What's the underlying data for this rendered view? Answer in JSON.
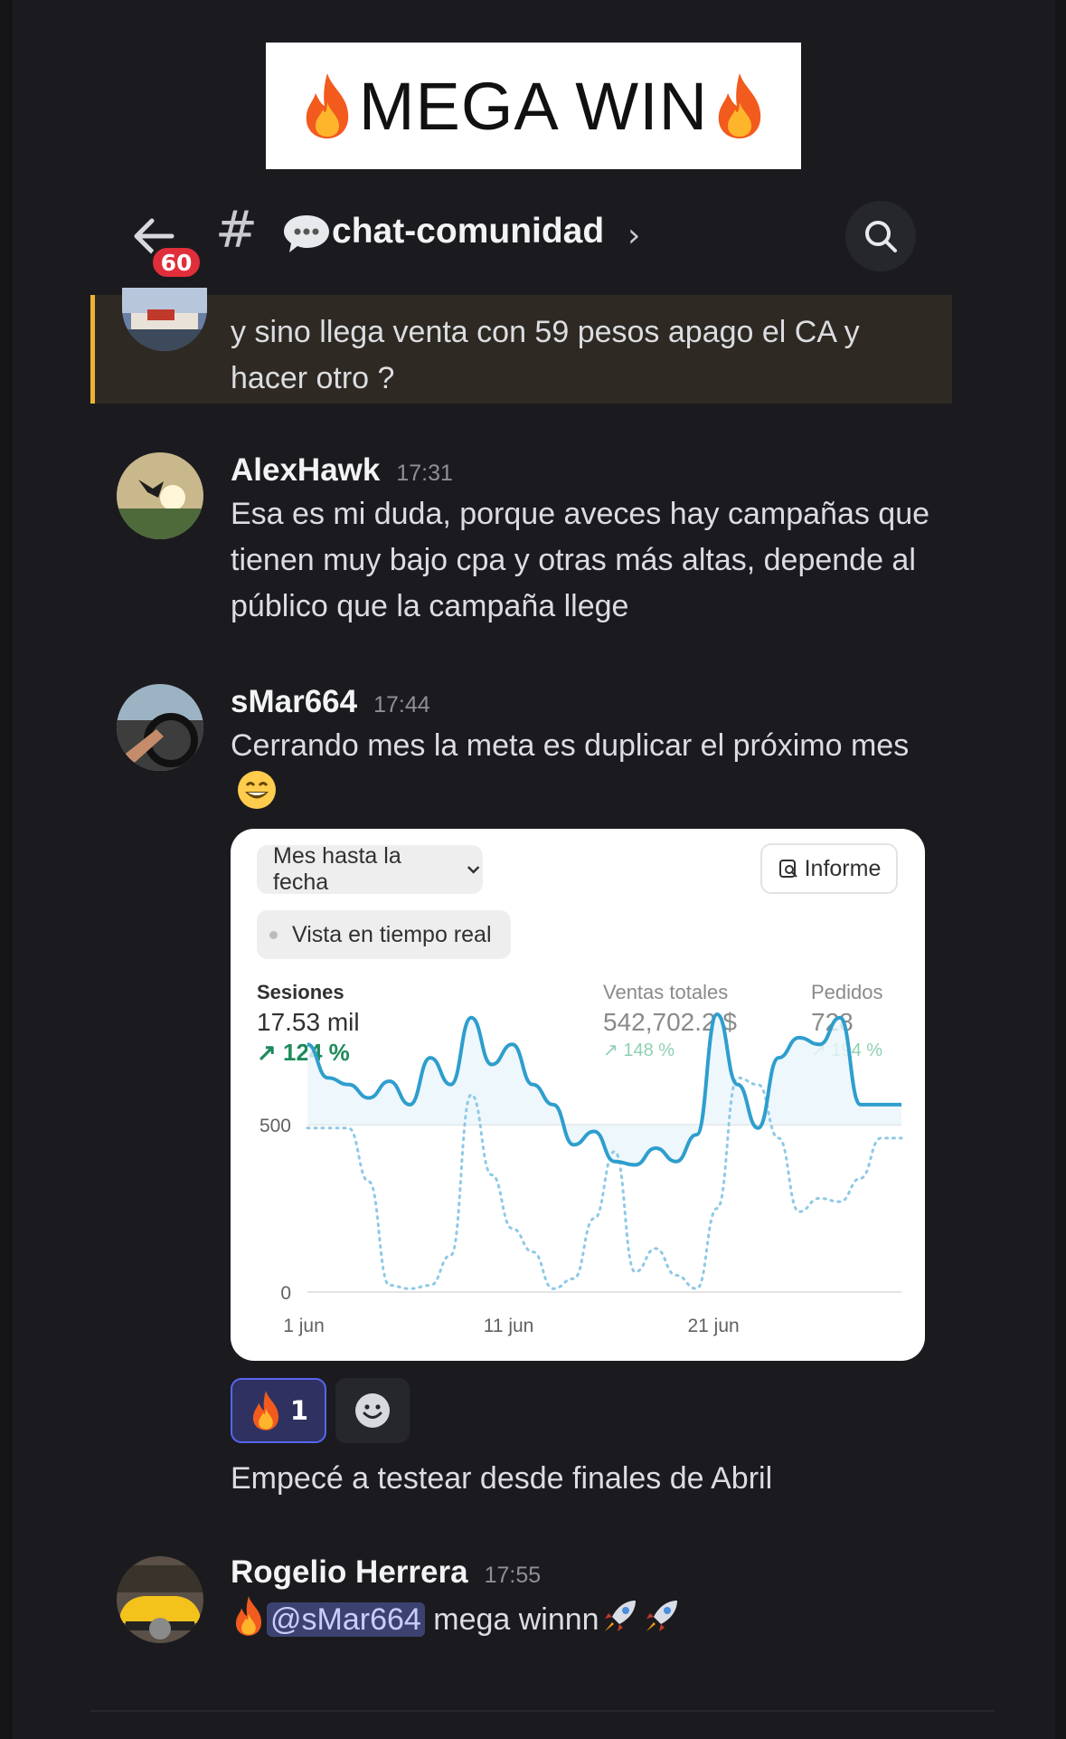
{
  "banner": {
    "title": "MEGA WIN"
  },
  "header": {
    "unread_badge": "60",
    "channel_name": "chat-comunidad"
  },
  "messages": {
    "highlighted": {
      "text": "y sino llega venta con 59  pesos  apago el CA  y hacer otro  ?"
    },
    "alexhawk": {
      "author": "AlexHawk",
      "time": "17:31",
      "text": "Esa es mi duda, porque aveces hay campañas que tienen muy bajo cpa y otras más altas, depende al público que la campaña llege"
    },
    "smar": {
      "author": "sMar664",
      "time": "17:44",
      "text": "Cerrando mes la meta es duplicar el próximo mes",
      "followup": "Empecé a testear desde finales de Abril",
      "reaction_count": "1"
    },
    "rogelio": {
      "author": "Rogelio Herrera",
      "time": "17:55",
      "mention": "@sMar664",
      "text": " mega winnn"
    }
  },
  "analytics_card": {
    "date_range": "Mes hasta la fecha",
    "live_view": "Vista en tiempo real",
    "report_button": "Informe",
    "metrics": [
      {
        "label": "Sesiones",
        "value": "17.53 mil",
        "delta": "124 %"
      },
      {
        "label": "Ventas totales",
        "value": "542,702.2 $",
        "delta": "148 %"
      },
      {
        "label": "Pedidos",
        "value": "728",
        "delta": "194 %"
      }
    ]
  },
  "colors": {
    "background": "#1b1b1f",
    "highlight_bg": "#2e2923",
    "highlight_bar": "#f0b232",
    "badge": "#e02e3a",
    "line_current": "#2e9ecd",
    "line_previous": "#8ec9e6",
    "delta_green": "#1e8a5a"
  },
  "chart_data": {
    "type": "line",
    "x_tick_labels": [
      "1 jun",
      "11 jun",
      "21 jun"
    ],
    "y_tick_labels": [
      "0",
      "500"
    ],
    "ylim": [
      0,
      900
    ],
    "x": [
      "1 jun",
      "2 jun",
      "3 jun",
      "4 jun",
      "5 jun",
      "6 jun",
      "7 jun",
      "8 jun",
      "9 jun",
      "10 jun",
      "11 jun",
      "12 jun",
      "13 jun",
      "14 jun",
      "15 jun",
      "16 jun",
      "17 jun",
      "18 jun",
      "19 jun",
      "20 jun",
      "21 jun",
      "22 jun",
      "23 jun",
      "24 jun",
      "25 jun",
      "26 jun",
      "27 jun",
      "28 jun",
      "29 jun",
      "30 jun"
    ],
    "series": [
      {
        "values": [
          740,
          640,
          620,
          580,
          630,
          560,
          700,
          620,
          820,
          680,
          740,
          620,
          560,
          440,
          480,
          390,
          380,
          430,
          390,
          470,
          830,
          620,
          490,
          700,
          760,
          740,
          820,
          560,
          560,
          560
        ]
      },
      {
        "values": [
          490,
          490,
          490,
          330,
          20,
          10,
          20,
          110,
          590,
          350,
          190,
          120,
          10,
          40,
          220,
          420,
          60,
          130,
          50,
          10,
          250,
          640,
          620,
          460,
          240,
          280,
          270,
          340,
          460,
          460
        ]
      }
    ]
  }
}
